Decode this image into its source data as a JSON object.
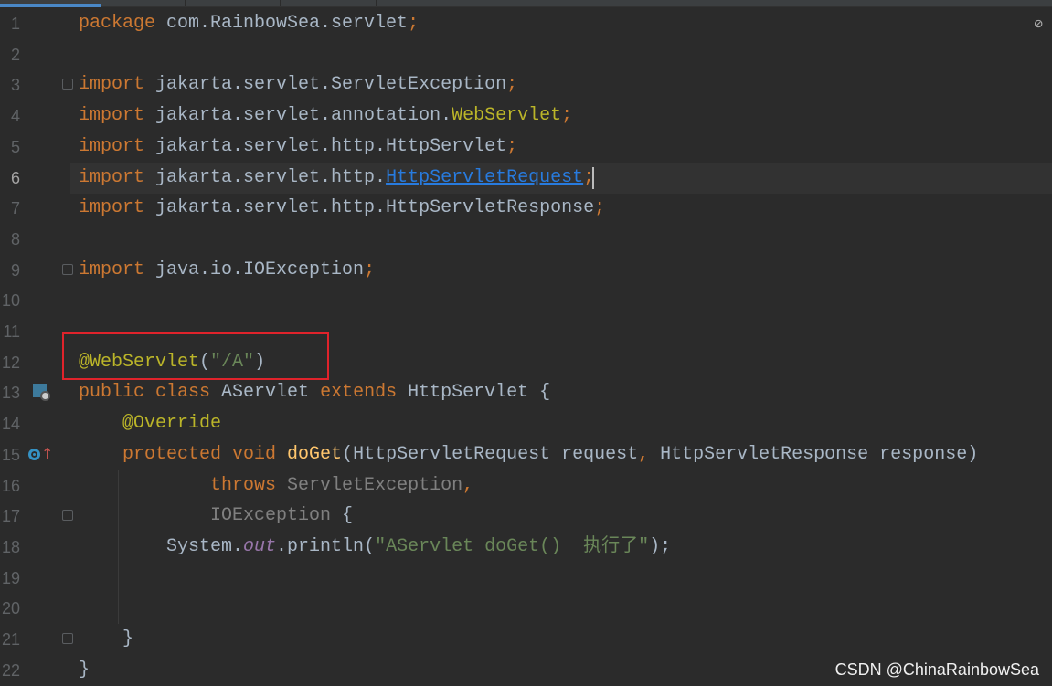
{
  "editor": {
    "current_line": 6,
    "lines": [
      [
        [
          "package ",
          "kw"
        ],
        [
          "com.RainbowSea.servlet",
          ""
        ],
        [
          ";",
          "kw"
        ]
      ],
      [],
      [
        [
          "import ",
          "kw"
        ],
        [
          "jakarta.servlet.ServletException",
          ""
        ],
        [
          ";",
          "kw"
        ]
      ],
      [
        [
          "import ",
          "kw"
        ],
        [
          "jakarta.servlet.annotation.",
          ""
        ],
        [
          "WebServlet",
          "an"
        ],
        [
          ";",
          "kw"
        ]
      ],
      [
        [
          "import ",
          "kw"
        ],
        [
          "jakarta.servlet.http.HttpServlet",
          ""
        ],
        [
          ";",
          "kw"
        ]
      ],
      [
        [
          "import ",
          "kw"
        ],
        [
          "jakarta.servlet.http.",
          ""
        ],
        [
          "HttpServletRequest",
          "lk"
        ],
        [
          ";",
          "kw"
        ]
      ],
      [
        [
          "import ",
          "kw"
        ],
        [
          "jakarta.servlet.http.HttpServletResponse",
          ""
        ],
        [
          ";",
          "kw"
        ]
      ],
      [],
      [
        [
          "import ",
          "kw"
        ],
        [
          "java.io.IOException",
          ""
        ],
        [
          ";",
          "kw"
        ]
      ],
      [],
      [],
      [
        [
          "@WebServlet",
          "an"
        ],
        [
          "(",
          ""
        ],
        [
          "\"/A\"",
          "st"
        ],
        [
          ")",
          ""
        ]
      ],
      [
        [
          "public class ",
          "kw"
        ],
        [
          "AServlet ",
          ""
        ],
        [
          "extends ",
          "kw"
        ],
        [
          "HttpServlet {",
          ""
        ]
      ],
      [
        [
          "    @Override",
          "an"
        ]
      ],
      [
        [
          "    protected void ",
          "kw"
        ],
        [
          "doGet",
          "fn"
        ],
        [
          "(HttpServletRequest request",
          ""
        ],
        [
          ", ",
          "kw"
        ],
        [
          "HttpServletResponse response)",
          ""
        ]
      ],
      [
        [
          "            throws ",
          "kw"
        ],
        [
          "ServletException",
          "gr"
        ],
        [
          ",",
          "kw"
        ]
      ],
      [
        [
          "            IOException ",
          "gr"
        ],
        [
          "{",
          ""
        ]
      ],
      [
        [
          "        System.",
          ""
        ],
        [
          "out",
          "out"
        ],
        [
          ".println(",
          ""
        ],
        [
          "\"AServlet doGet()  执行了\"",
          "st"
        ],
        [
          ");",
          ""
        ]
      ],
      [],
      [],
      [
        [
          "    }",
          ""
        ]
      ],
      [
        [
          "}",
          ""
        ]
      ]
    ]
  },
  "gutter_icons": {
    "13": "servlet-web-icon",
    "15": "override-method-icon"
  },
  "watermark": "CSDN @ChinaRainbowSea",
  "colors": {
    "background": "#2b2b2b",
    "keyword": "#cc7832",
    "annotation": "#bbb529",
    "string": "#6a8759",
    "highlight_box": "#e0232b"
  }
}
